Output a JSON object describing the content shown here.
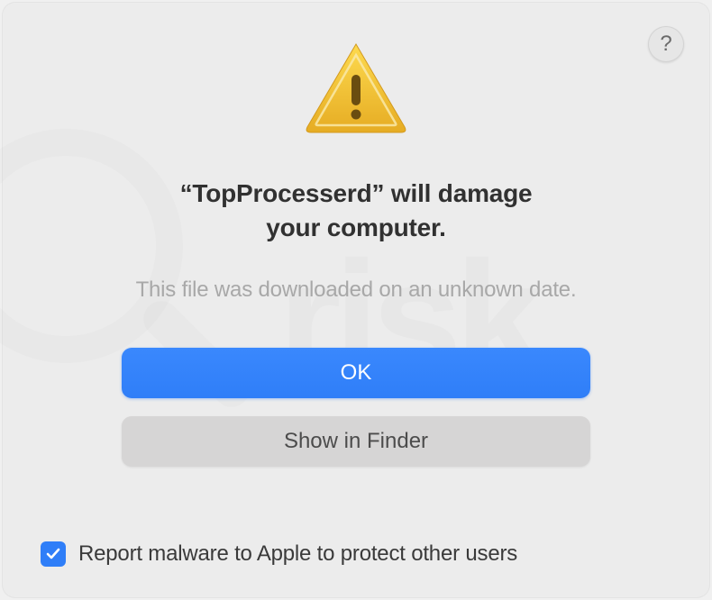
{
  "help_label": "?",
  "title_line1": "“TopProcesserd” will damage",
  "title_line2": "your computer.",
  "subtitle": "This file was downloaded on an unknown date.",
  "buttons": {
    "primary": "OK",
    "secondary": "Show in Finder"
  },
  "checkbox": {
    "label": "Report malware to Apple to protect other users",
    "checked": true
  }
}
